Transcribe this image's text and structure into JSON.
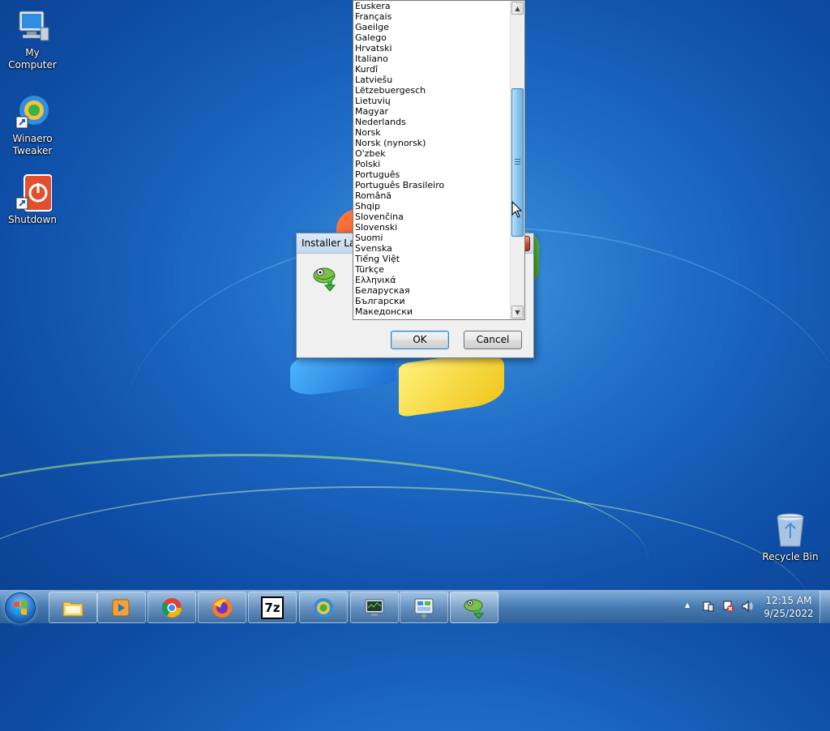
{
  "desktop": {
    "icons": [
      {
        "label_line1": "My Computer",
        "label_line2": "",
        "icon": "computer-icon"
      },
      {
        "label_line1": "Winaero",
        "label_line2": "Tweaker",
        "icon": "winaero-icon"
      },
      {
        "label_line1": "Shutdown",
        "label_line2": "",
        "icon": "power-icon"
      },
      {
        "label_line1": "Recycle Bin",
        "label_line2": "",
        "icon": "recycle-bin-icon"
      }
    ]
  },
  "dialog": {
    "title": "Installer Lan",
    "close_glyph": "x",
    "ok_label": "OK",
    "cancel_label": "Cancel",
    "icon": "chameleon-installer-icon"
  },
  "dropdown": {
    "items": [
      "Euskera",
      "Français",
      "Gaeilge",
      "Galego",
      "Hrvatski",
      "Italiano",
      "Kurdî",
      "Latviešu",
      "Lëtzebuergesch",
      "Lietuvių",
      "Magyar",
      "Nederlands",
      "Norsk",
      "Norsk (nynorsk)",
      "O'zbek",
      "Polski",
      "Português",
      "Português Brasileiro",
      "Română",
      "Shqip",
      "Slovenčina",
      "Slovenski",
      "Suomi",
      "Svenska",
      "Tiếng Việt",
      "Türkçe",
      "Ελληνικά",
      "Беларуская",
      "Български",
      "Македонски"
    ],
    "scroll_up_glyph": "▲",
    "scroll_down_glyph": "▼"
  },
  "taskbar": {
    "start_icon": "windows-start-icon",
    "pinned": [
      {
        "name": "explorer",
        "icon": "folder-icon"
      },
      {
        "name": "media player",
        "icon": "media-player-icon"
      },
      {
        "name": "chrome",
        "icon": "chrome-icon"
      },
      {
        "name": "firefox",
        "icon": "firefox-icon"
      },
      {
        "name": "7-zip",
        "icon": "7zip-icon",
        "text": "7z"
      },
      {
        "name": "winaero",
        "icon": "winaero-icon"
      },
      {
        "name": "task manager",
        "icon": "monitor-icon"
      },
      {
        "name": "control panel",
        "icon": "control-panel-icon"
      },
      {
        "name": "installer",
        "icon": "chameleon-installer-icon"
      }
    ],
    "tray": {
      "arrow": "▲",
      "clock_time": "12:15 AM",
      "clock_date": "9/25/2022"
    }
  },
  "colors": {
    "accent": "#3c7fb1",
    "desktop_blue": "#1e6cc6"
  }
}
